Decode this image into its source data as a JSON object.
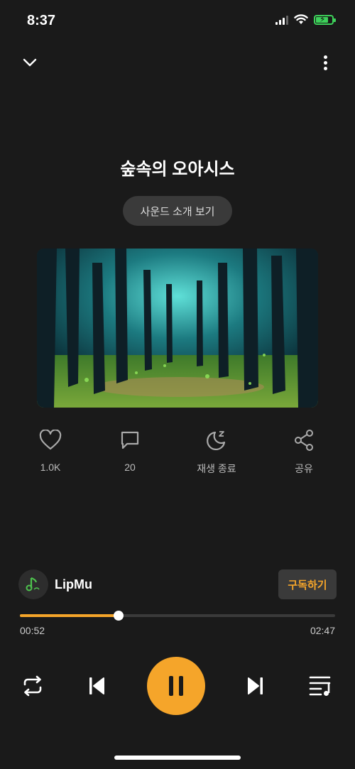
{
  "status_bar": {
    "time": "8:37"
  },
  "player": {
    "title": "숲속의 오아시스",
    "intro_button": "사운드 소개 보기",
    "cover_alt": "Forest illustration"
  },
  "actions": {
    "like": {
      "label": "1.0K",
      "icon": "heart-icon"
    },
    "comment": {
      "label": "20",
      "icon": "comment-icon"
    },
    "sleep_timer": {
      "label": "재생 종료",
      "icon": "moon-sleep-icon"
    },
    "share": {
      "label": "공유",
      "icon": "share-icon"
    }
  },
  "artist": {
    "name": "LipMu",
    "subscribe_label": "구독하기"
  },
  "progress": {
    "current": "00:52",
    "total": "02:47",
    "fraction": 0.312
  },
  "colors": {
    "accent": "#f5a52a",
    "background": "#1a1a1a",
    "battery": "#3dd15a"
  }
}
